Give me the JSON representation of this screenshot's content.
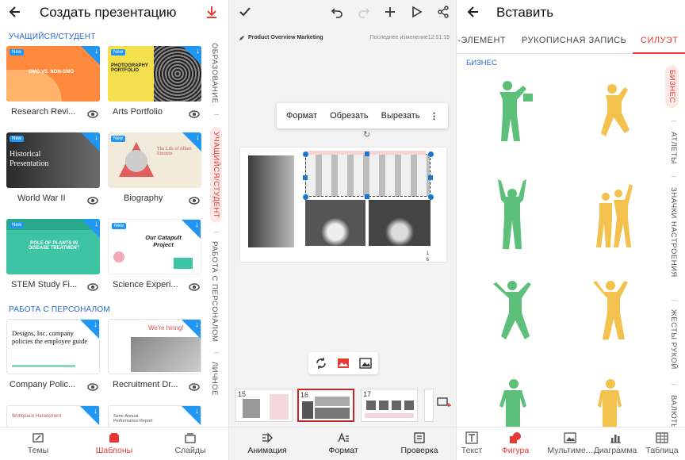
{
  "panel1": {
    "title": "Создать презентацию",
    "section_student": "УЧАЩИЙСЯ/СТУДЕНТ",
    "section_staff": "РАБОТА С ПЕРСОНАЛОМ",
    "cards": [
      {
        "label": "Research Revi...",
        "thumb_title": "GMO VS. NON-GMO",
        "bg": "#ff8a3d",
        "new": "New"
      },
      {
        "label": "Arts Portfolio",
        "thumb_title": "PHOTOGRAPHY PORTFOLIO",
        "bg": "#f4e04d",
        "new": "New"
      },
      {
        "label": "World War II",
        "thumb_title": "Historical Presentation",
        "bg": "#333333",
        "new": "New"
      },
      {
        "label": "Biography",
        "thumb_title": "The Life of Albert Einstein",
        "bg": "#f2ebdb",
        "new": "New"
      },
      {
        "label": "STEM Study Fi...",
        "thumb_title": "ROLE OF PLANTS IN DISEASE TREATMENT",
        "bg": "#3cc4a3",
        "new": "New"
      },
      {
        "label": "Science Experi...",
        "thumb_title": "Our Catapult Project",
        "bg": "#ffffff",
        "new": "New"
      },
      {
        "label": "Company Polic...",
        "thumb_title": "Designs, Inc. company policies the employee guide",
        "bg": "#ffffff",
        "new": ""
      },
      {
        "label": "Recruitment Dr...",
        "thumb_title": "We're hiring!",
        "bg": "#d94f4f",
        "new": ""
      },
      {
        "label": "",
        "thumb_title": "Workplace Harassment",
        "bg": "#ffffff",
        "new": ""
      },
      {
        "label": "",
        "thumb_title": "Semi-Annual Performance Report",
        "bg": "#ffffff",
        "new": ""
      }
    ],
    "vtabs": [
      "ОБРАЗОВАНИЕ",
      "УЧАЩИЙСЯ/СТУДЕНТ",
      "РАБОТА С ПЕРСОНАЛОМ",
      "ЛИЧНОЕ"
    ],
    "bottom_nav": [
      "Темы",
      "Шаблоны",
      "Слайды"
    ]
  },
  "panel2": {
    "file_name": "Product Overview Marketing",
    "last_modified": "Последнее изменение12:51:19",
    "context_menu": [
      "Формат",
      "Обрезать",
      "Вырезать"
    ],
    "slide_page_numbers": "1\n6",
    "thumbs": [
      "15",
      "16",
      "17"
    ],
    "bottom_nav": [
      "Анимация",
      "Формат",
      "Проверка"
    ]
  },
  "panel3": {
    "title": "Вставить",
    "tabs": [
      "Т-ЭЛЕМЕНТ",
      "РУКОПИСНАЯ ЗАПИСЬ",
      "СИЛУЭТ"
    ],
    "category": "БИЗНЕС",
    "rtabs": [
      "БИЗНЕС",
      "АТЛЕТЫ",
      "ЗНАЧКИ НАСТРОЕНИЯ",
      "ЖЕСТЫ РУКОЙ",
      "ВАЛЮТЫ"
    ],
    "bottom_nav": [
      "Текст",
      "Фигура",
      "Мультиме...",
      "Диаграмма",
      "Таблица"
    ]
  },
  "colors": {
    "accent": "#e53935",
    "link": "#2c6ad1",
    "green": "#5cbf7a",
    "yellow": "#f2c14e"
  }
}
